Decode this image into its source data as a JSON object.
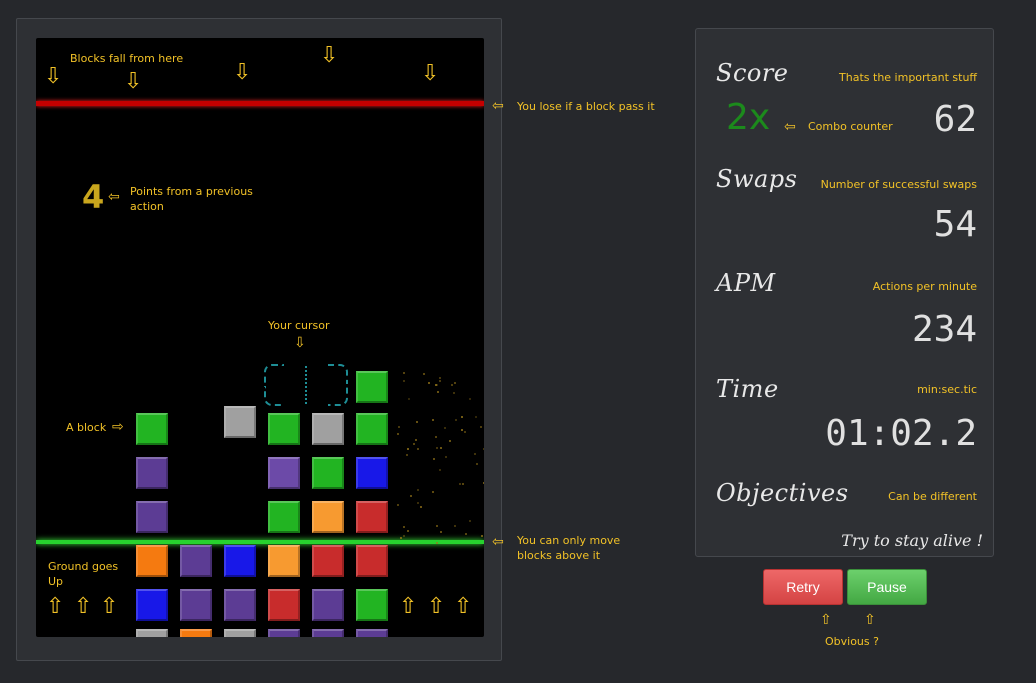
{
  "annotations": {
    "blocks_fall": "Blocks fall from here",
    "lose_line": "You lose if a block pass it",
    "points_prev_line1": "Points from a previous",
    "points_prev_line2": "action",
    "your_cursor": "Your cursor",
    "a_block": "A block",
    "ground_goes_line1": "Ground goes",
    "ground_goes_line2": "Up",
    "move_above_line1": "You can only move",
    "move_above_line2": "blocks above it",
    "combo_counter": "Combo counter",
    "obvious": "Obvious ?"
  },
  "board": {
    "previous_points": "4"
  },
  "stats": {
    "score": {
      "label": "Score",
      "note": "Thats the important stuff",
      "value": "62",
      "combo": "2x"
    },
    "swaps": {
      "label": "Swaps",
      "note": "Number of successful swaps",
      "value": "54"
    },
    "apm": {
      "label": "APM",
      "note": "Actions per minute",
      "value": "234"
    },
    "time": {
      "label": "Time",
      "note": "min:sec.tic",
      "value": "01:02.2"
    },
    "objectives": {
      "label": "Objectives",
      "note": "Can be different",
      "text": "Try to stay alive !"
    }
  },
  "buttons": {
    "retry": "Retry",
    "pause": "Pause"
  },
  "colors": {
    "green": "#22b422",
    "purple": "#5c3c94",
    "blue": "#1818e8",
    "orange": "#f57a10",
    "red": "#c82c2c",
    "gray": "#a0a0a0",
    "lightorange": "#f79a30",
    "magenta": "#6c4aa8"
  },
  "icons": {
    "down_arrow": "⇩",
    "up_arrow": "⇧",
    "left_arrow": "⇦",
    "right_arrow": "⇨"
  }
}
